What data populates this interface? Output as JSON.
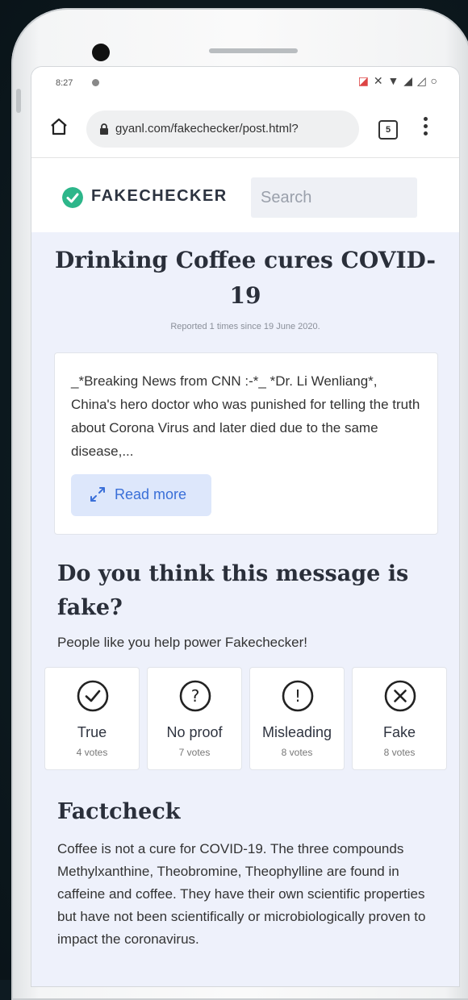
{
  "status_bar": {
    "time": "8:27"
  },
  "browser": {
    "url": "gyanl.com/fakechecker/post.html?",
    "tab_count": "5"
  },
  "site": {
    "logo_text": "FAKECHECKER",
    "search_placeholder": "Search"
  },
  "article": {
    "title": "Drinking Coffee cures COVID-19",
    "reported": "Reported 1 times since 19 June 2020.",
    "message": "_*Breaking News from CNN :-*_ *Dr. Li Wenliang*, China's hero doctor who was punished for telling the truth about Corona Virus and later died due to the same disease,...",
    "read_more": "Read more"
  },
  "poll": {
    "question": "Do you think this message is fake?",
    "subtitle": "People like you help power Fakechecker!",
    "options": [
      {
        "label": "True",
        "votes": "4 votes",
        "icon": "check-circle-icon"
      },
      {
        "label": "No proof",
        "votes": "7 votes",
        "icon": "question-circle-icon"
      },
      {
        "label": "Misleading",
        "votes": "8 votes",
        "icon": "exclamation-circle-icon"
      },
      {
        "label": "Fake",
        "votes": "8 votes",
        "icon": "x-circle-icon"
      }
    ]
  },
  "factcheck": {
    "title": "Factcheck",
    "body": "Coffee is not a cure for COVID-19. The three compounds Methylxanthine, Theobromine, Theophylline are found in caffeine and coffee. They have their own scientific properties but have not been scientifically or microbiologically proven to impact the coronavirus."
  },
  "colors": {
    "brand": "#2db68a",
    "link": "#3a6fd8",
    "page_bg": "#eef1fb"
  }
}
